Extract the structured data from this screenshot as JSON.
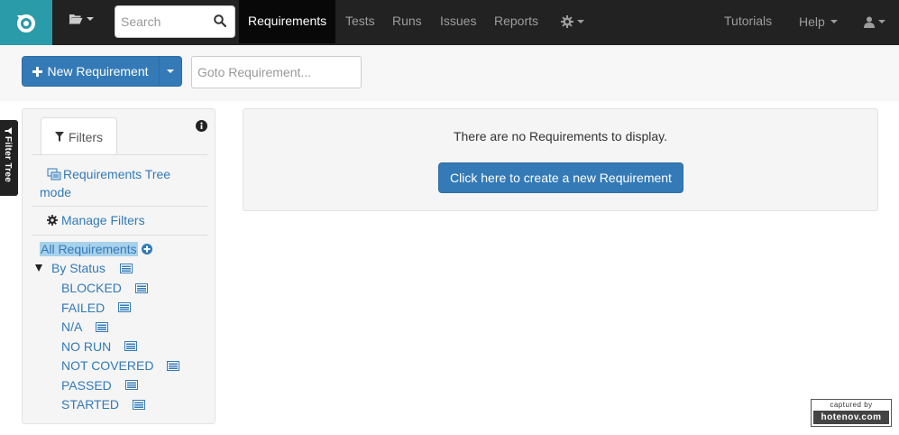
{
  "colors": {
    "navbar": "#222222",
    "brand": "#2a9ba8",
    "primary": "#337ab7",
    "link": "#337ab7",
    "highlight": "#a8d1eb"
  },
  "navbar": {
    "logo_icon": "refresh-logo-icon",
    "folder_icon": "folder-open-icon",
    "search": {
      "placeholder": "Search",
      "icon": "search-icon"
    },
    "links": {
      "requirements": "Requirements",
      "tests": "Tests",
      "runs": "Runs",
      "issues": "Issues",
      "reports": "Reports"
    },
    "settings_icon": "gear-icon",
    "tutorials": "Tutorials",
    "help": "Help",
    "user_icon": "user-icon"
  },
  "toolbar": {
    "new_requirement": "New Requirement",
    "goto_placeholder": "Goto Requirement..."
  },
  "filter_tree_tab": "Filter Tree",
  "filters": {
    "tab_label": "Filters",
    "tree_mode": "Requirements Tree mode",
    "manage": "Manage Filters",
    "all_requirements": "All Requirements",
    "by_status": "By Status",
    "statuses": [
      "BLOCKED",
      "FAILED",
      "N/A",
      "NO RUN",
      "NOT COVERED",
      "PASSED",
      "STARTED"
    ]
  },
  "main": {
    "empty_message": "There are no Requirements to display.",
    "create_button": "Click here to create a new Requirement"
  },
  "watermark": {
    "top": "captured by",
    "bottom": "hotenov.com"
  }
}
